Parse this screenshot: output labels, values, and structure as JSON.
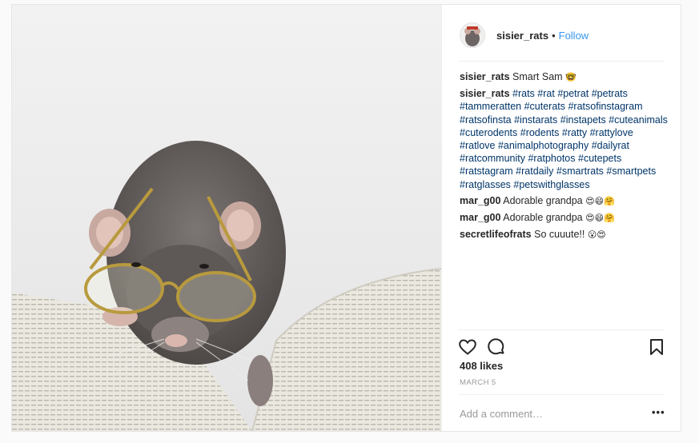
{
  "post": {
    "username": "sisier_rats",
    "separator": "•",
    "follow_label": "Follow",
    "caption": {
      "user": "sisier_rats",
      "text": "Smart Sam",
      "emoji": "🤓"
    },
    "tags_comment": {
      "user": "sisier_rats",
      "tags": "#rats #rat #petrat #petrats #tammeratten #cuterats #ratsofinstagram #ratsofinsta #instarats #instapets #cuteanimals #cuterodents #rodents #ratty #rattylove #ratlove #animalphotography #dailyrat #ratcommunity #ratphotos #cutepets #ratstagram #ratdaily #smartrats #smartpets #ratglasses #petswithglasses"
    },
    "comments": [
      {
        "user": "mar_g00",
        "text": "Adorable grandpa",
        "emoji": "😍😄🤗"
      },
      {
        "user": "mar_g00",
        "text": "Adorable grandpa",
        "emoji": "😍😄🤗"
      },
      {
        "user": "secretlifeofrats",
        "text": "So cuuute!!",
        "emoji": "😮😍"
      }
    ],
    "likes": "408 likes",
    "date": "MARCH 5",
    "add_comment_placeholder": "Add a comment…",
    "more_label": "•••",
    "icons": {
      "like": "heart-outline-icon",
      "comment": "speech-bubble-icon",
      "save": "bookmark-icon"
    },
    "colors": {
      "link": "#3897f0",
      "hashtag": "#003569",
      "muted": "#999999"
    }
  }
}
